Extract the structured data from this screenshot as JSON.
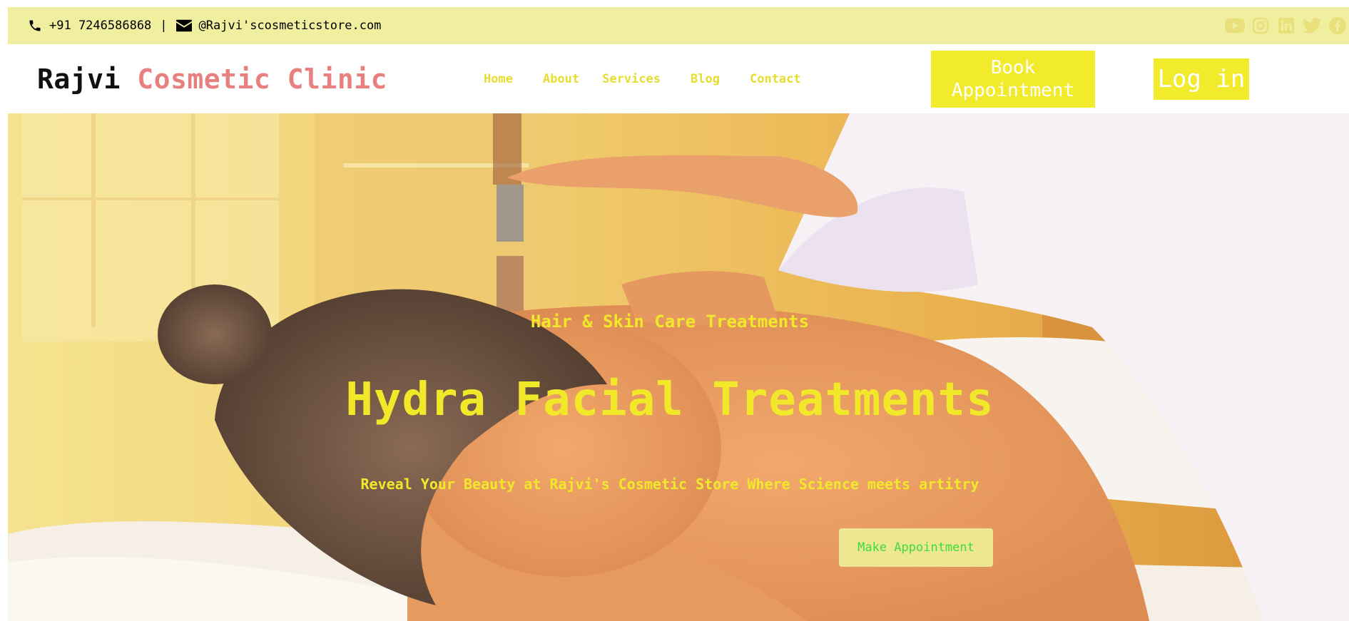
{
  "topbar": {
    "phone": "+91 7246586868",
    "separator": "|",
    "email": "@Rajvi'scosmeticstore.com",
    "phone_icon": "phone-icon",
    "email_icon": "envelope-icon",
    "socials": [
      "youtube-icon",
      "instagram-icon",
      "linkedin-icon",
      "twitter-icon",
      "facebook-icon"
    ],
    "background": "#f0ee9f",
    "social_color": "#e8e07a"
  },
  "header": {
    "brand_first": "Rajvi",
    "brand_second": "Cosmetic Clinic",
    "nav": {
      "home": "Home",
      "about": "About",
      "services": "Services",
      "blog": "Blog",
      "contact": "Contact"
    },
    "book_line1": "Book",
    "book_line2": "Appointment",
    "login": "Log in",
    "accent": "#f2eb2c",
    "brand_color": "#e98080"
  },
  "hero": {
    "subtitle": "Hair & Skin Care Treatments",
    "title": "Hydra Facial Treatments",
    "tagline": "Reveal Your Beauty at Rajvi's Cosmetic Store Where Science meets artitry",
    "cta": "Make Appointment",
    "text_color": "#f2e82a"
  }
}
